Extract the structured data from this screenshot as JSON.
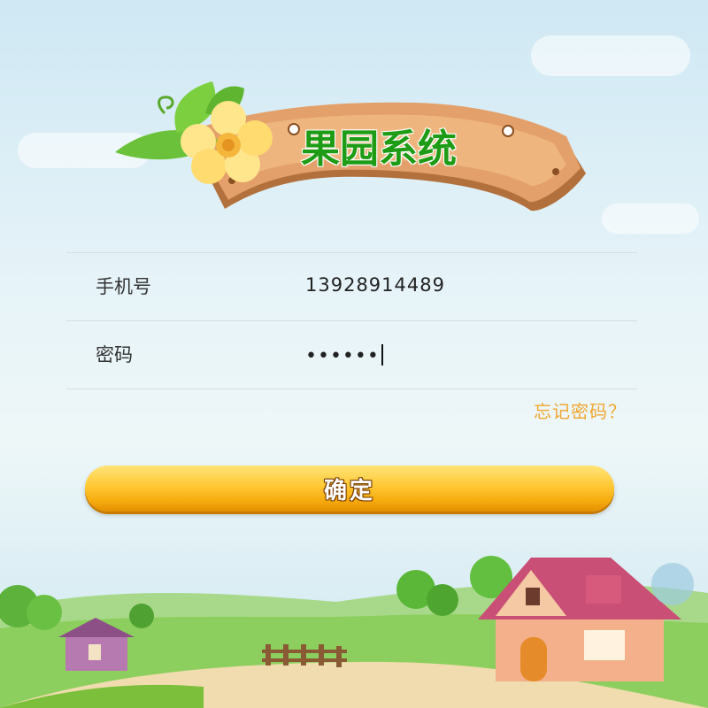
{
  "app": {
    "title": "果园系统"
  },
  "form": {
    "phone_label": "手机号",
    "phone_value": "13928914489",
    "password_label": "密码",
    "password_value": "••••••"
  },
  "links": {
    "forgot_password": "忘记密码？"
  },
  "actions": {
    "confirm_label": "确定"
  },
  "colors": {
    "title": "#1f9c16",
    "forgot_link": "#f0a62e",
    "button": "#f7ad10",
    "sign_wood": "#d8925a"
  },
  "icons": [
    "flower-icon",
    "leaf-icon",
    "wood-sign",
    "farm-house",
    "fence"
  ]
}
